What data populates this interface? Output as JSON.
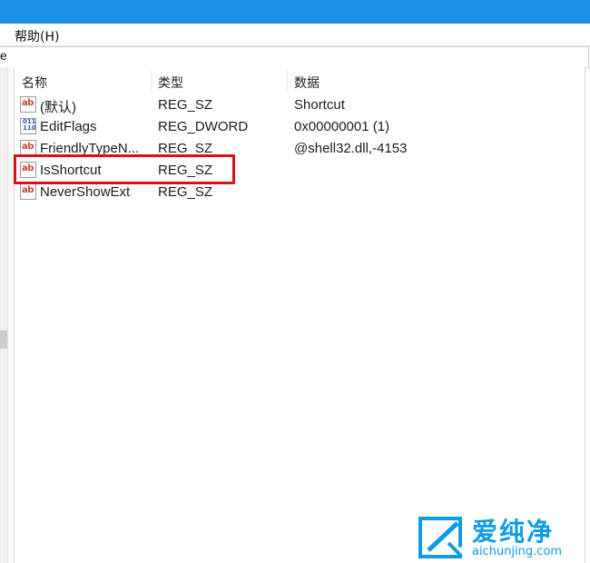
{
  "menu": {
    "help_label": "帮助(H)"
  },
  "address": {
    "value": "e"
  },
  "columns": {
    "name": "名称",
    "type": "类型",
    "data": "数据"
  },
  "rows": [
    {
      "icon": "string-value-icon",
      "icon_text": "ab",
      "name": "(默认)",
      "type": "REG_SZ",
      "data": "Shortcut"
    },
    {
      "icon": "binary-value-icon",
      "icon_text": "011 110",
      "name": "EditFlags",
      "type": "REG_DWORD",
      "data": "0x00000001 (1)"
    },
    {
      "icon": "string-value-icon",
      "icon_text": "ab",
      "name": "FriendlyTypeN...",
      "type": "REG_SZ",
      "data": "@shell32.dll,-4153"
    },
    {
      "icon": "string-value-icon",
      "icon_text": "ab",
      "name": "IsShortcut",
      "type": "REG_SZ",
      "data": ""
    },
    {
      "icon": "string-value-icon",
      "icon_text": "ab",
      "name": "NeverShowExt",
      "type": "REG_SZ",
      "data": ""
    }
  ],
  "highlight": {
    "color": "#d8121b",
    "row_name": "IsShortcut"
  },
  "watermark": {
    "brand": "爱纯净",
    "url": "aichunjing.com",
    "color": "#0e9be8"
  },
  "colors": {
    "titlebar": "#1e8fe6"
  }
}
